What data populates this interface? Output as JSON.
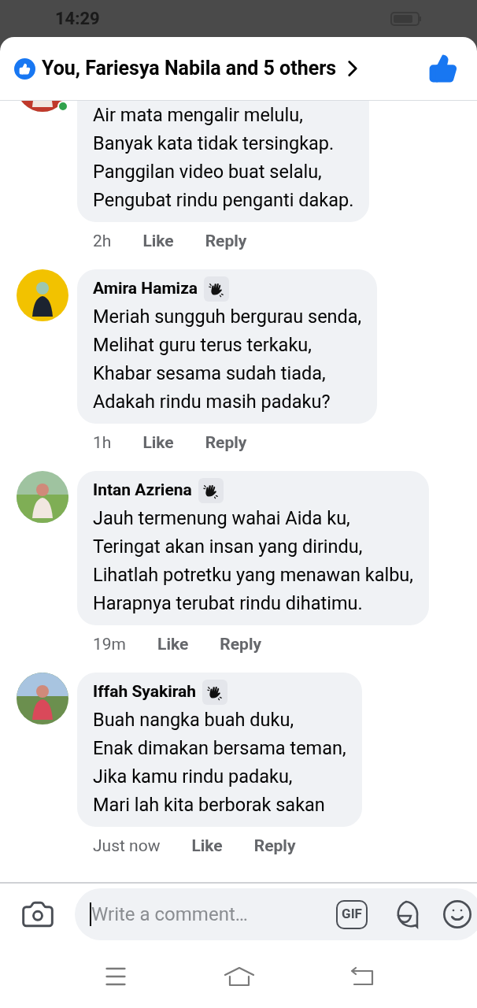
{
  "status_bar": {
    "time": "14:29"
  },
  "header": {
    "reactions_text": "You, Fariesya Nabila and 5 others"
  },
  "comments": [
    {
      "online": true,
      "lines": [
        "Air mata mengalir melulu,",
        "Banyak kata tidak tersingkap.",
        "Panggilan video buat selalu,",
        "Pengubat rindu penganti dakap."
      ],
      "time": "2h",
      "like": "Like",
      "reply": "Reply"
    },
    {
      "name": "Amira Hamiza",
      "badge": true,
      "lines": [
        "Meriah sungguh bergurau senda,",
        "Melihat guru terus terkaku,",
        "Khabar sesama sudah tiada,",
        "Adakah rindu masih padaku?"
      ],
      "time": "1h",
      "like": "Like",
      "reply": "Reply"
    },
    {
      "name": "Intan Azriena",
      "badge": true,
      "lines": [
        "Jauh termenung wahai Aida ku,",
        "Teringat akan insan yang dirindu,",
        "Lihatlah potretku yang menawan kalbu,",
        "Harapnya terubat rindu dihatimu."
      ],
      "time": "19m",
      "like": "Like",
      "reply": "Reply"
    },
    {
      "name": "Iffah Syakirah",
      "badge": true,
      "lines": [
        "Buah nangka buah duku,",
        "Enak dimakan bersama teman,",
        "Jika kamu rindu padaku,",
        "Mari lah kita berborak sakan"
      ],
      "time": "Just now",
      "like": "Like",
      "reply": "Reply"
    }
  ],
  "composer": {
    "placeholder": "Write a comment…",
    "gif_label": "GIF"
  }
}
